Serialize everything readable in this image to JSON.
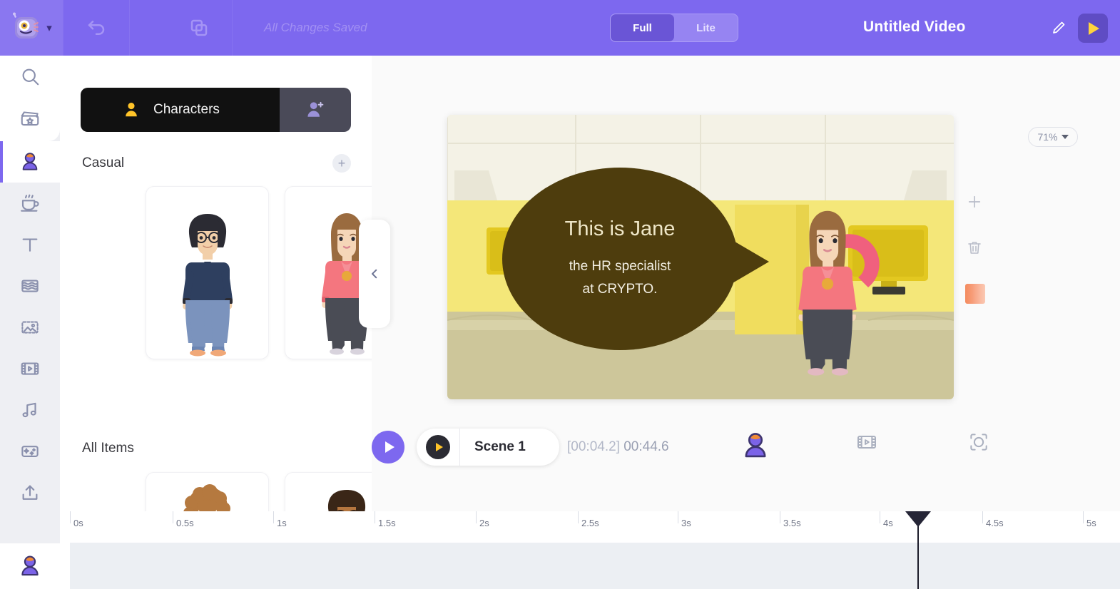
{
  "topbar": {
    "logo_name": "app-logo-robot",
    "undo_label": "Undo",
    "copy_label": "Duplicate",
    "save_status": "All Changes Saved",
    "modes": [
      {
        "label": "Full",
        "active": true
      },
      {
        "label": "Lite",
        "active": false
      }
    ],
    "video_title": "Untitled Video",
    "edit_title_label": "Rename",
    "preview_label": "Preview"
  },
  "rail": {
    "items": [
      {
        "name": "search",
        "label": "Search",
        "active": false
      },
      {
        "name": "scenes",
        "label": "Scenes",
        "active": false
      },
      {
        "name": "characters",
        "label": "Characters",
        "active": true
      },
      {
        "name": "props",
        "label": "Props",
        "active": false
      },
      {
        "name": "text",
        "label": "Text",
        "active": false
      },
      {
        "name": "background",
        "label": "Background",
        "active": false
      },
      {
        "name": "images",
        "label": "Images",
        "active": false
      },
      {
        "name": "video",
        "label": "Video",
        "active": false
      },
      {
        "name": "music",
        "label": "Music",
        "active": false
      },
      {
        "name": "effects",
        "label": "Effects",
        "active": false
      },
      {
        "name": "upload",
        "label": "Upload",
        "active": false
      }
    ],
    "account_label": "Account"
  },
  "panel": {
    "tabs": [
      {
        "label": "Characters",
        "icon": "person-icon",
        "active": true
      },
      {
        "label": "",
        "icon": "person-add-icon",
        "active": false
      }
    ],
    "sections": [
      {
        "title": "Casual",
        "has_add": true
      },
      {
        "title": "All Items",
        "has_add": false
      }
    ],
    "casual_items": [
      {
        "name": "character-man-glasses-navy-sweater"
      },
      {
        "name": "character-woman-pink-hoodie"
      }
    ],
    "all_items": [
      {
        "name": "character-man-curly-hair-navy-hoodie"
      },
      {
        "name": "character-man-orange-shirt-glasses"
      }
    ],
    "collapse_label": "Collapse panel"
  },
  "stage": {
    "zoom_level": "71%",
    "canvas": {
      "bubble_line1": "This is Jane",
      "bubble_line2": "the HR specialist",
      "bubble_line3": "at CRYPTO.",
      "bubble_color": "#4e3d0d",
      "bubble_text_color": "#efe7c8"
    },
    "side_tools": [
      {
        "name": "add-icon",
        "label": "Add"
      },
      {
        "name": "trash-icon",
        "label": "Delete"
      },
      {
        "name": "color-swatch",
        "label": "Color"
      }
    ]
  },
  "scene_bar": {
    "play_label": "Play",
    "scene_name": "Scene 1",
    "current_time": "[00:04.2]",
    "total_time": "00:44.6",
    "tools": [
      {
        "name": "character-icon",
        "label": "Characters"
      },
      {
        "name": "film-icon",
        "label": "Scene settings"
      },
      {
        "name": "focus-icon",
        "label": "Focus"
      }
    ]
  },
  "timeline": {
    "ticks": [
      "0s",
      "0.5s",
      "1s",
      "1.5s",
      "2s",
      "2.5s",
      "3s",
      "3.5s",
      "4s",
      "4.5s",
      "5s"
    ],
    "playhead_time": "4.2s",
    "track_label": "Scene track"
  },
  "colors": {
    "brand_purple": "#7d68ef",
    "accent_yellow": "#ffd33d",
    "panel_dark": "#111111",
    "rail_bg": "#eeeff3"
  }
}
